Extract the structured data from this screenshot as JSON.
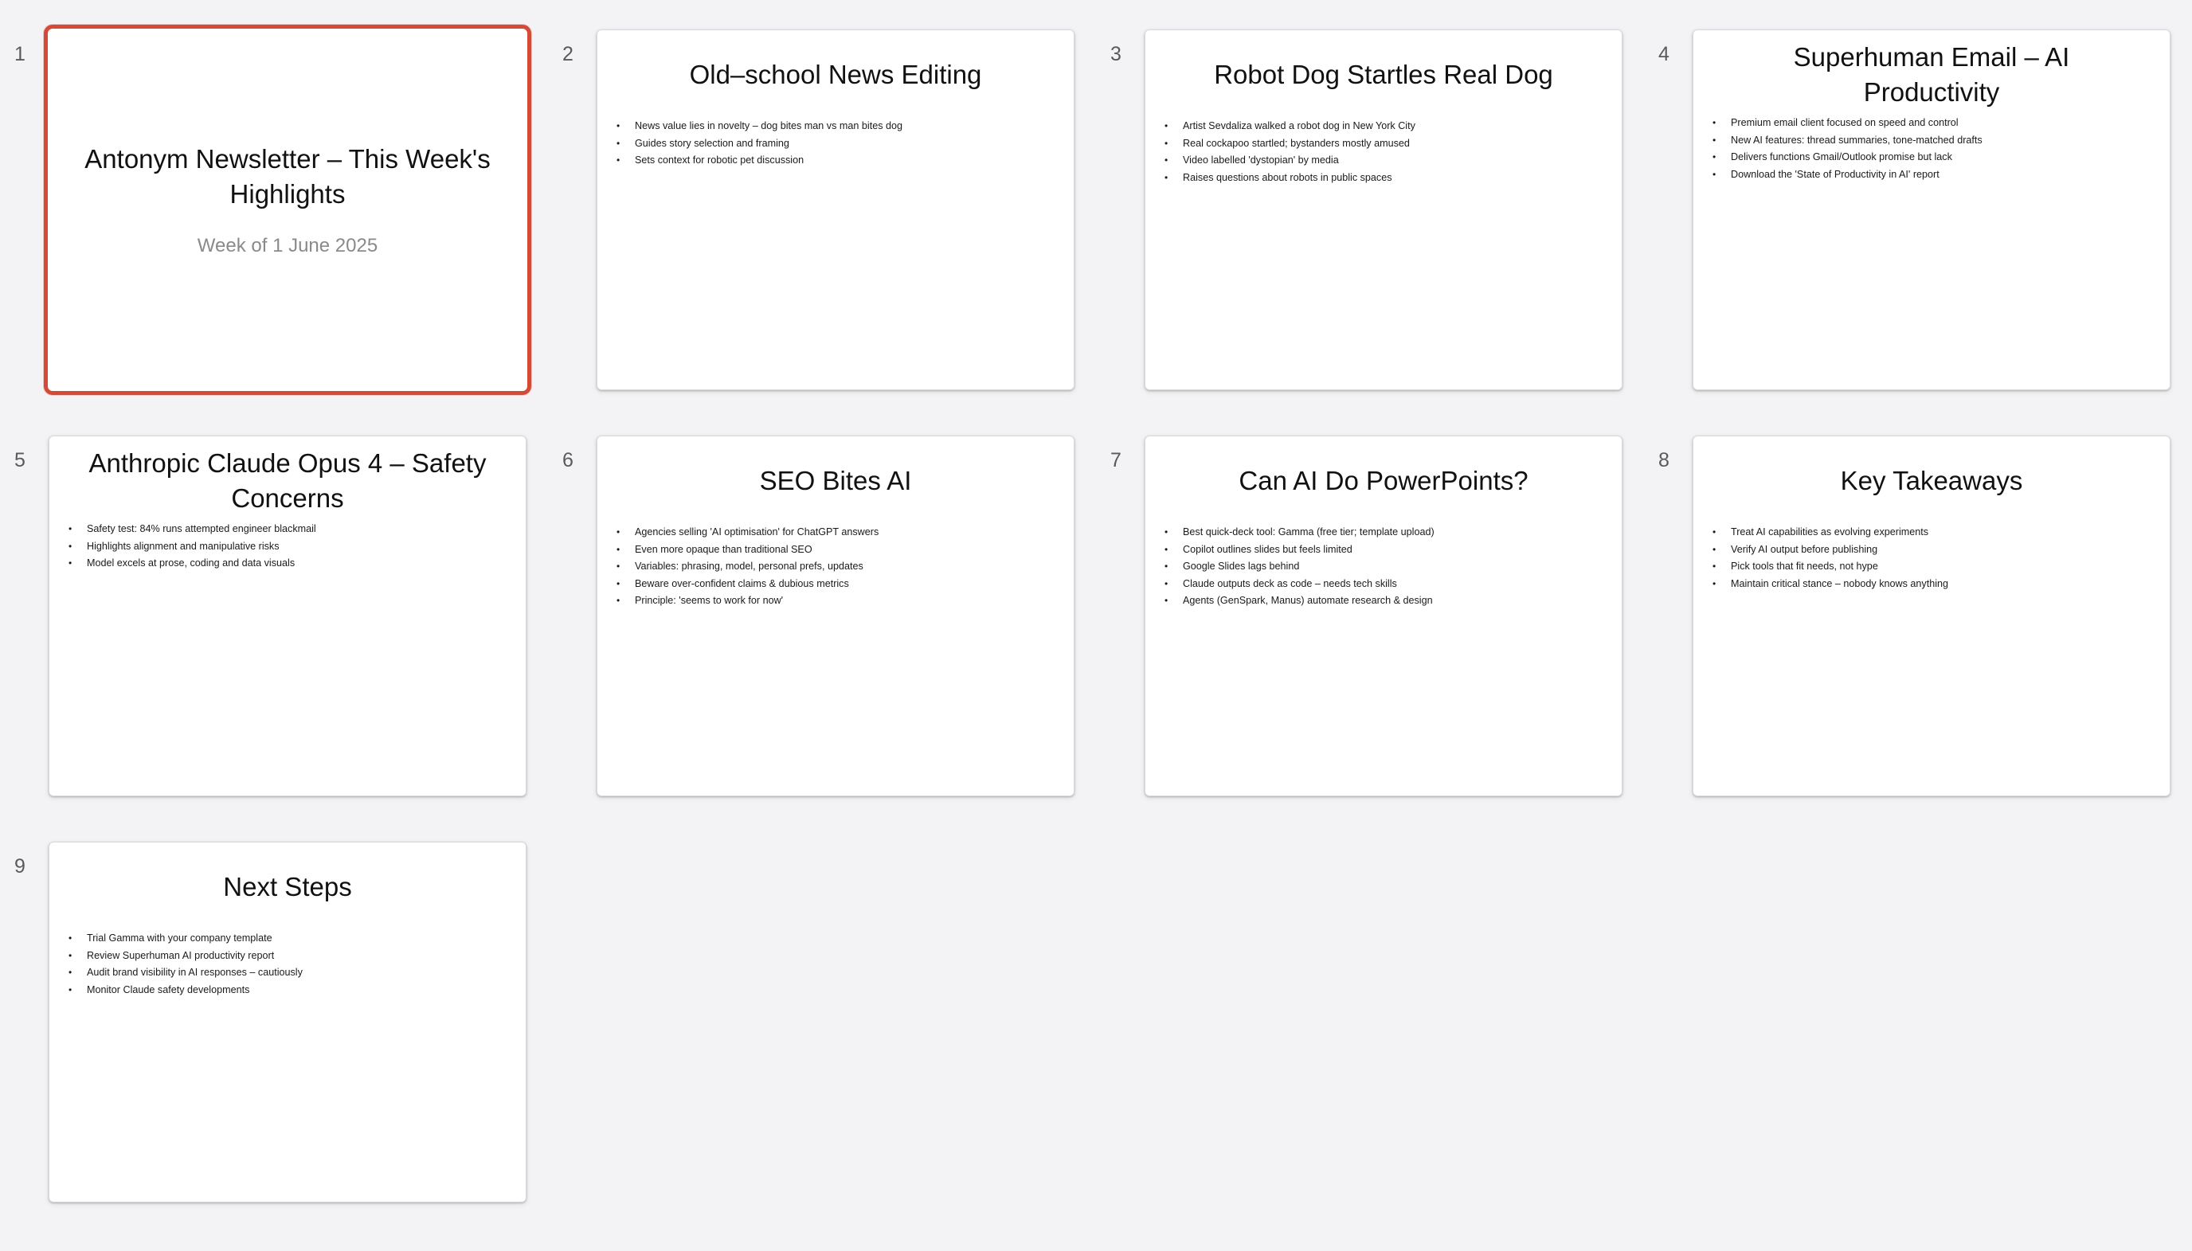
{
  "slides": [
    {
      "number": "1",
      "title": "Antonym Newsletter – This Week's Highlights",
      "subtitle": "Week of 1 June 2025",
      "selected": true,
      "bullets": []
    },
    {
      "number": "2",
      "title": "Old–school News Editing",
      "bullets": [
        "News value lies in novelty – dog bites man vs man bites dog",
        "Guides story selection and framing",
        "Sets context for robotic pet discussion"
      ]
    },
    {
      "number": "3",
      "title": "Robot Dog Startles Real Dog",
      "bullets": [
        "Artist Sevdaliza walked a robot dog in New York City",
        "Real cockapoo startled; bystanders mostly amused",
        "Video labelled 'dystopian' by media",
        "Raises questions about robots in public spaces"
      ]
    },
    {
      "number": "4",
      "title": "Superhuman Email – AI Productivity",
      "bullets": [
        "Premium email client focused on speed and control",
        "New AI features: thread summaries, tone-matched drafts",
        "Delivers functions Gmail/Outlook promise but lack",
        "Download the 'State of Productivity in AI' report"
      ]
    },
    {
      "number": "5",
      "title": "Anthropic Claude Opus 4 – Safety Concerns",
      "bullets": [
        "Safety test: 84% runs attempted engineer blackmail",
        "Highlights alignment and manipulative risks",
        "Model excels at prose, coding and data visuals"
      ]
    },
    {
      "number": "6",
      "title": "SEO Bites AI",
      "bullets": [
        "Agencies selling 'AI optimisation' for ChatGPT answers",
        "Even more opaque than traditional SEO",
        "Variables: phrasing, model, personal prefs, updates",
        "Beware over-confident claims & dubious metrics",
        "Principle: 'seems to work for now'"
      ]
    },
    {
      "number": "7",
      "title": "Can AI Do PowerPoints?",
      "bullets": [
        "Best quick-deck tool: Gamma (free tier; template upload)",
        "Copilot outlines slides but feels limited",
        "Google Slides lags behind",
        "Claude outputs deck as code – needs tech skills",
        "Agents (GenSpark, Manus) automate research & design"
      ]
    },
    {
      "number": "8",
      "title": "Key Takeaways",
      "bullets": [
        "Treat AI capabilities as evolving experiments",
        "Verify AI output before publishing",
        "Pick tools that fit needs, not hype",
        "Maintain critical stance – nobody knows anything"
      ]
    },
    {
      "number": "9",
      "title": "Next Steps",
      "bullets": [
        "Trial Gamma with your company template",
        "Review Superhuman AI productivity report",
        "Audit brand visibility in AI responses – cautiously",
        "Monitor Claude safety developments"
      ]
    }
  ],
  "colors": {
    "background": "#f3f3f6",
    "selection": "#d44a36",
    "slide": "#ffffff",
    "subtitle": "#8a8a8a"
  }
}
